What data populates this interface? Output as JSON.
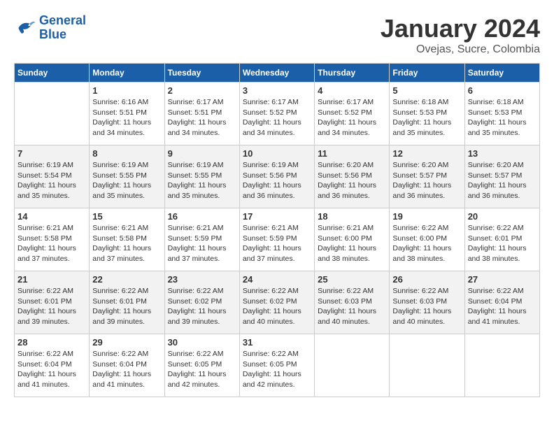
{
  "logo": {
    "line1": "General",
    "line2": "Blue"
  },
  "title": "January 2024",
  "subtitle": "Ovejas, Sucre, Colombia",
  "days_header": [
    "Sunday",
    "Monday",
    "Tuesday",
    "Wednesday",
    "Thursday",
    "Friday",
    "Saturday"
  ],
  "weeks": [
    [
      {
        "day": "",
        "info": ""
      },
      {
        "day": "1",
        "info": "Sunrise: 6:16 AM\nSunset: 5:51 PM\nDaylight: 11 hours\nand 34 minutes."
      },
      {
        "day": "2",
        "info": "Sunrise: 6:17 AM\nSunset: 5:51 PM\nDaylight: 11 hours\nand 34 minutes."
      },
      {
        "day": "3",
        "info": "Sunrise: 6:17 AM\nSunset: 5:52 PM\nDaylight: 11 hours\nand 34 minutes."
      },
      {
        "day": "4",
        "info": "Sunrise: 6:17 AM\nSunset: 5:52 PM\nDaylight: 11 hours\nand 34 minutes."
      },
      {
        "day": "5",
        "info": "Sunrise: 6:18 AM\nSunset: 5:53 PM\nDaylight: 11 hours\nand 35 minutes."
      },
      {
        "day": "6",
        "info": "Sunrise: 6:18 AM\nSunset: 5:53 PM\nDaylight: 11 hours\nand 35 minutes."
      }
    ],
    [
      {
        "day": "7",
        "info": "Sunrise: 6:19 AM\nSunset: 5:54 PM\nDaylight: 11 hours\nand 35 minutes."
      },
      {
        "day": "8",
        "info": "Sunrise: 6:19 AM\nSunset: 5:55 PM\nDaylight: 11 hours\nand 35 minutes."
      },
      {
        "day": "9",
        "info": "Sunrise: 6:19 AM\nSunset: 5:55 PM\nDaylight: 11 hours\nand 35 minutes."
      },
      {
        "day": "10",
        "info": "Sunrise: 6:19 AM\nSunset: 5:56 PM\nDaylight: 11 hours\nand 36 minutes."
      },
      {
        "day": "11",
        "info": "Sunrise: 6:20 AM\nSunset: 5:56 PM\nDaylight: 11 hours\nand 36 minutes."
      },
      {
        "day": "12",
        "info": "Sunrise: 6:20 AM\nSunset: 5:57 PM\nDaylight: 11 hours\nand 36 minutes."
      },
      {
        "day": "13",
        "info": "Sunrise: 6:20 AM\nSunset: 5:57 PM\nDaylight: 11 hours\nand 36 minutes."
      }
    ],
    [
      {
        "day": "14",
        "info": "Sunrise: 6:21 AM\nSunset: 5:58 PM\nDaylight: 11 hours\nand 37 minutes."
      },
      {
        "day": "15",
        "info": "Sunrise: 6:21 AM\nSunset: 5:58 PM\nDaylight: 11 hours\nand 37 minutes."
      },
      {
        "day": "16",
        "info": "Sunrise: 6:21 AM\nSunset: 5:59 PM\nDaylight: 11 hours\nand 37 minutes."
      },
      {
        "day": "17",
        "info": "Sunrise: 6:21 AM\nSunset: 5:59 PM\nDaylight: 11 hours\nand 37 minutes."
      },
      {
        "day": "18",
        "info": "Sunrise: 6:21 AM\nSunset: 6:00 PM\nDaylight: 11 hours\nand 38 minutes."
      },
      {
        "day": "19",
        "info": "Sunrise: 6:22 AM\nSunset: 6:00 PM\nDaylight: 11 hours\nand 38 minutes."
      },
      {
        "day": "20",
        "info": "Sunrise: 6:22 AM\nSunset: 6:01 PM\nDaylight: 11 hours\nand 38 minutes."
      }
    ],
    [
      {
        "day": "21",
        "info": "Sunrise: 6:22 AM\nSunset: 6:01 PM\nDaylight: 11 hours\nand 39 minutes."
      },
      {
        "day": "22",
        "info": "Sunrise: 6:22 AM\nSunset: 6:01 PM\nDaylight: 11 hours\nand 39 minutes."
      },
      {
        "day": "23",
        "info": "Sunrise: 6:22 AM\nSunset: 6:02 PM\nDaylight: 11 hours\nand 39 minutes."
      },
      {
        "day": "24",
        "info": "Sunrise: 6:22 AM\nSunset: 6:02 PM\nDaylight: 11 hours\nand 40 minutes."
      },
      {
        "day": "25",
        "info": "Sunrise: 6:22 AM\nSunset: 6:03 PM\nDaylight: 11 hours\nand 40 minutes."
      },
      {
        "day": "26",
        "info": "Sunrise: 6:22 AM\nSunset: 6:03 PM\nDaylight: 11 hours\nand 40 minutes."
      },
      {
        "day": "27",
        "info": "Sunrise: 6:22 AM\nSunset: 6:04 PM\nDaylight: 11 hours\nand 41 minutes."
      }
    ],
    [
      {
        "day": "28",
        "info": "Sunrise: 6:22 AM\nSunset: 6:04 PM\nDaylight: 11 hours\nand 41 minutes."
      },
      {
        "day": "29",
        "info": "Sunrise: 6:22 AM\nSunset: 6:04 PM\nDaylight: 11 hours\nand 41 minutes."
      },
      {
        "day": "30",
        "info": "Sunrise: 6:22 AM\nSunset: 6:05 PM\nDaylight: 11 hours\nand 42 minutes."
      },
      {
        "day": "31",
        "info": "Sunrise: 6:22 AM\nSunset: 6:05 PM\nDaylight: 11 hours\nand 42 minutes."
      },
      {
        "day": "",
        "info": ""
      },
      {
        "day": "",
        "info": ""
      },
      {
        "day": "",
        "info": ""
      }
    ]
  ]
}
